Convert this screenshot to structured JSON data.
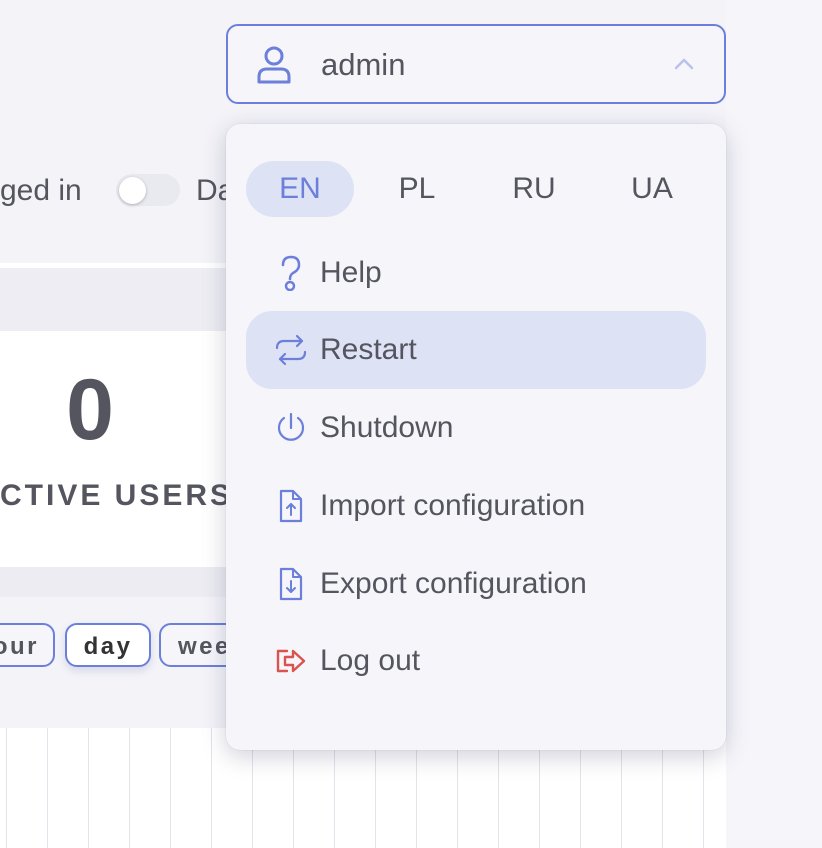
{
  "user_menu": {
    "username": "admin",
    "icons": {
      "user": "user-icon",
      "toggle": "chevron-up-icon"
    },
    "languages": [
      {
        "code": "EN",
        "active": true
      },
      {
        "code": "PL",
        "active": false
      },
      {
        "code": "RU",
        "active": false
      },
      {
        "code": "UA",
        "active": false
      }
    ],
    "items": [
      {
        "label": "Help",
        "icon": "question-icon"
      },
      {
        "label": "Restart",
        "icon": "restart-icon",
        "highlighted": true
      },
      {
        "label": "Shutdown",
        "icon": "power-icon"
      },
      {
        "label": "Import configuration",
        "icon": "file-upload-icon"
      },
      {
        "label": "Export configuration",
        "icon": "file-download-icon"
      },
      {
        "label": "Log out",
        "icon": "logout-icon"
      }
    ]
  },
  "background": {
    "logged_in_label": "ged in",
    "day_toggle_label": "Da",
    "stat": {
      "value": "0",
      "label": "CTIVE USERS"
    },
    "period_pills": [
      "our",
      "day",
      "wee"
    ],
    "active_period": "day"
  },
  "colors": {
    "accent": "#6c7fdb",
    "highlight": "#dde2f5",
    "logout": "#d9534f",
    "text": "#55555f",
    "panel": "#f5f5fa"
  }
}
